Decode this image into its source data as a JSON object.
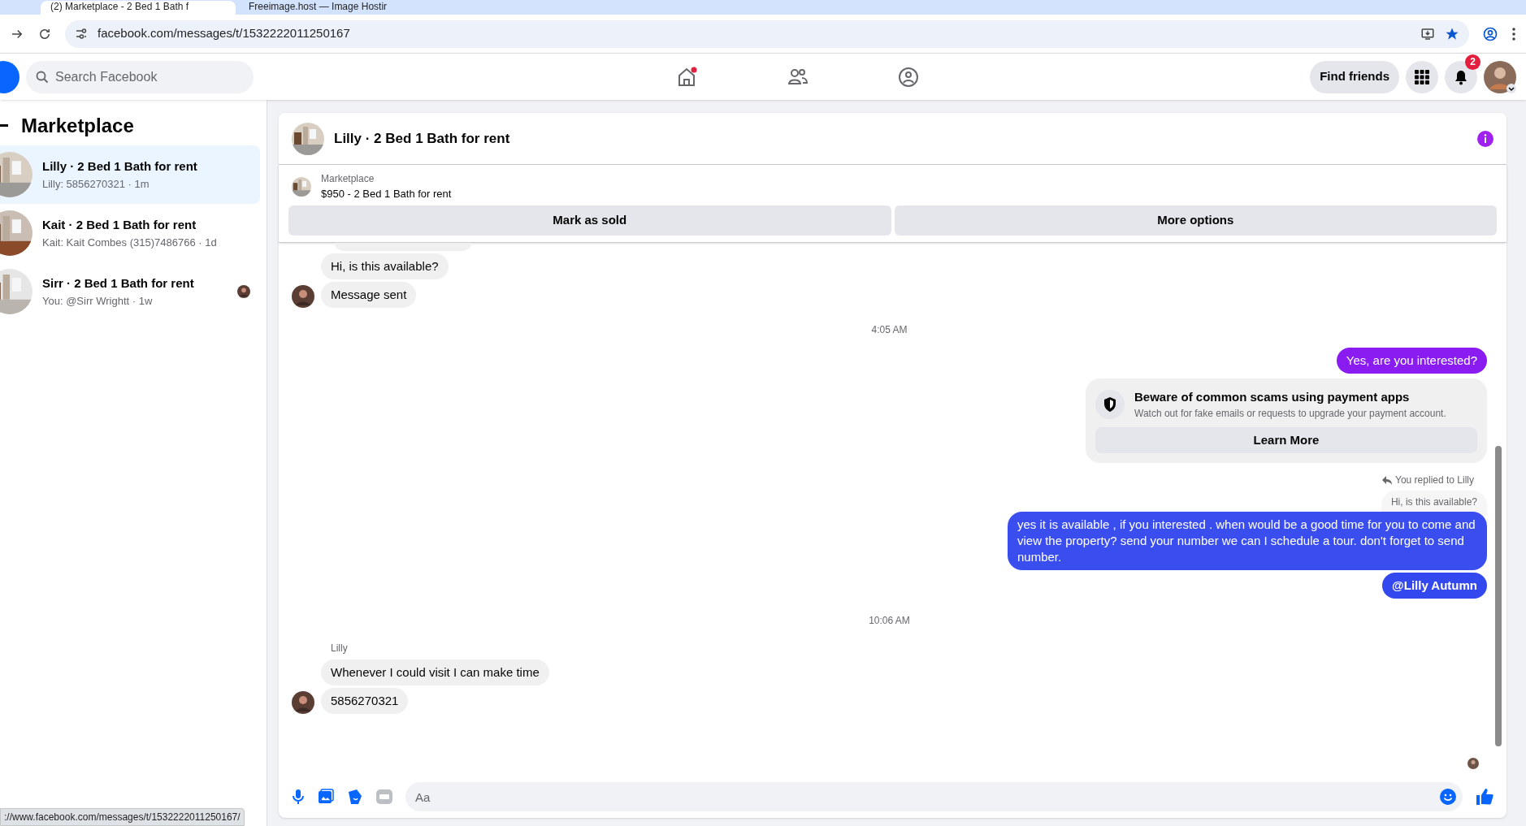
{
  "browser": {
    "tabs": [
      {
        "title": "(2) Marketplace - 2 Bed 1 Bath f",
        "selected": true
      },
      {
        "title": "Freeimage.host — Image Hostir",
        "selected": false
      }
    ],
    "url": "facebook.com/messages/t/1532222011250167"
  },
  "header": {
    "search_placeholder": "Search Facebook",
    "find_friends": "Find friends",
    "notification_count": "2"
  },
  "sidebar": {
    "title": "Marketplace",
    "items": [
      {
        "title": "Lilly · 2 Bed 1 Bath for rent",
        "preview": "Lilly: 5856270321 · 1m",
        "selected": true,
        "seen": false
      },
      {
        "title": "Kait · 2 Bed 1 Bath for rent",
        "preview": "Kait: Kait Combes (315)7486766 · 1d",
        "selected": false,
        "seen": false
      },
      {
        "title": "Sirr · 2 Bed 1 Bath for rent",
        "preview": "You: @Sirr Wrightt · 1w",
        "selected": false,
        "seen": true
      }
    ]
  },
  "chat": {
    "title": "Lilly · 2 Bed 1 Bath for rent",
    "listing": {
      "label": "Marketplace",
      "title": "$950 - 2 Bed 1 Bath for rent"
    },
    "actions": [
      "Mark as sold",
      "More options"
    ],
    "messages": [
      {
        "kind": "incoming",
        "text": "Hi, is this available?",
        "avatar": false
      },
      {
        "kind": "incoming",
        "text": "Message sent",
        "avatar": true
      },
      {
        "kind": "time",
        "text": "4:05 AM"
      },
      {
        "kind": "outgoing",
        "text": "Yes, are you interested?",
        "color": "#8a1cf2"
      },
      {
        "kind": "warning",
        "title": "Beware of common scams using payment apps",
        "text": "Watch out for fake emails or requests to upgrade your payment account.",
        "button": "Learn More"
      },
      {
        "kind": "reply",
        "label": "You replied to Lilly",
        "quote": "Hi, is this available?"
      },
      {
        "kind": "outgoing",
        "text": "yes it is available , if you interested . when would    be  a good time for you to come and view the  property? send your number we can I schedule  a tour. don't forget to send  number.",
        "color": "#3a4ef0"
      },
      {
        "kind": "outgoing",
        "text": "@Lilly Autumn",
        "color": "#3448f0"
      },
      {
        "kind": "time",
        "text": "10:06 AM"
      },
      {
        "kind": "sender",
        "text": "Lilly"
      },
      {
        "kind": "incoming",
        "text": "Whenever I could visit I can make time",
        "avatar": false
      },
      {
        "kind": "incoming",
        "text": "5856270321",
        "avatar": true
      }
    ],
    "composer_placeholder": "Aa"
  },
  "status_url": "://www.facebook.com/messages/t/1532222011250167/"
}
